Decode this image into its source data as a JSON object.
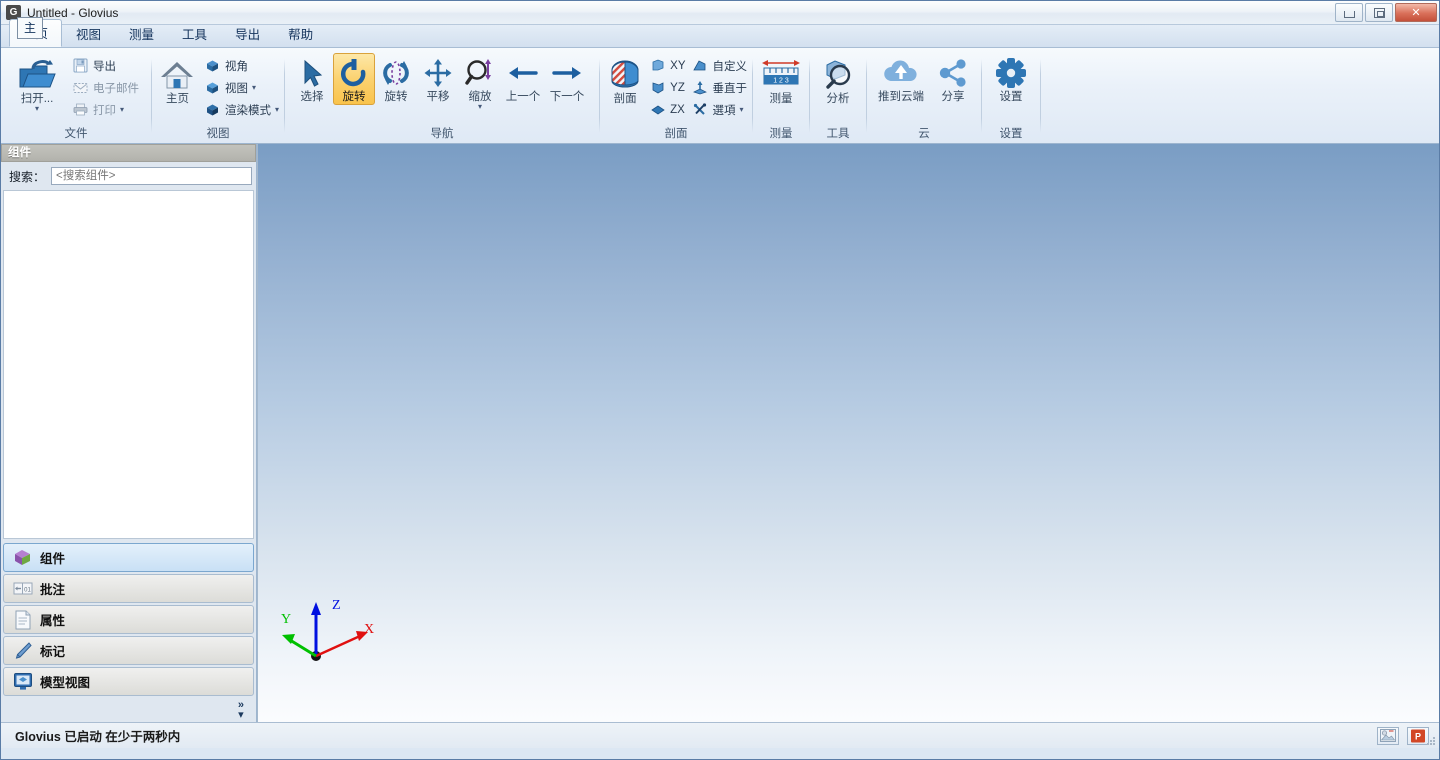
{
  "window": {
    "app_initial": "G",
    "title": "Untitled - Glovius",
    "controls": {
      "minimize": "minimize-button",
      "maximize": "maximize-button",
      "close": "✕"
    }
  },
  "menu": {
    "tabs": [
      {
        "label": "主页",
        "active": true
      },
      {
        "label": "视图",
        "active": false
      },
      {
        "label": "测量",
        "active": false
      },
      {
        "label": "工具",
        "active": false
      },
      {
        "label": "导出",
        "active": false
      },
      {
        "label": "帮助",
        "active": false
      }
    ],
    "ghost_overlay": "主"
  },
  "ribbon": {
    "groups": [
      {
        "name": "file",
        "label": "文件",
        "big": [
          {
            "label": "扫开...",
            "icon": "open-folder-icon",
            "selected": false,
            "caret": true
          }
        ],
        "small": [
          {
            "label": "导出",
            "icon": "save-export-icon",
            "caret": false
          },
          {
            "label": "电子邮件",
            "icon": "email-icon",
            "caret": false
          },
          {
            "label": "打印",
            "icon": "print-icon",
            "caret": true
          }
        ]
      },
      {
        "name": "view",
        "label": "视图",
        "big": [
          {
            "label": "主页",
            "icon": "home-icon",
            "selected": false,
            "caret": false
          }
        ],
        "small": [
          {
            "label": "视角",
            "icon": "viewpoint-cube-icon",
            "caret": false
          },
          {
            "label": "视图",
            "icon": "view-cube-icon",
            "caret": true
          },
          {
            "label": "渲染模式",
            "icon": "render-mode-cube-icon",
            "caret": true
          }
        ]
      },
      {
        "name": "navigation",
        "label": "导航",
        "big": [
          {
            "label": "选择",
            "icon": "cursor-arrow-icon",
            "selected": false,
            "caret": false
          },
          {
            "label": "旋转",
            "icon": "rotate-icon",
            "selected": true,
            "caret": false
          },
          {
            "label": "旋转",
            "icon": "spin-icon",
            "selected": false,
            "caret": false
          },
          {
            "label": "平移",
            "icon": "pan-icon",
            "selected": false,
            "caret": false
          },
          {
            "label": "缩放",
            "icon": "zoom-icon",
            "selected": false,
            "caret": true
          },
          {
            "label": "上一个",
            "icon": "arrow-left-icon",
            "selected": false,
            "caret": false
          },
          {
            "label": "下一个",
            "icon": "arrow-right-icon",
            "selected": false,
            "caret": false
          }
        ],
        "small": []
      },
      {
        "name": "section",
        "label": "剖面",
        "big": [
          {
            "label": "剖面",
            "icon": "section-cut-icon",
            "selected": false,
            "caret": false
          }
        ],
        "small_two_col": [
          [
            {
              "label": "XY",
              "icon": "plane-xy-icon",
              "caret": false
            },
            {
              "label": "YZ",
              "icon": "plane-yz-icon",
              "caret": false
            },
            {
              "label": "ZX",
              "icon": "plane-zx-icon",
              "caret": false
            }
          ],
          [
            {
              "label": "自定义",
              "icon": "custom-plane-icon",
              "caret": false
            },
            {
              "label": "垂直于",
              "icon": "perpendicular-icon",
              "caret": false
            },
            {
              "label": "選項",
              "icon": "tools-options-icon",
              "caret": true
            }
          ]
        ]
      },
      {
        "name": "measure",
        "label": "测量",
        "big": [
          {
            "label": "测量",
            "icon": "ruler-measure-icon",
            "selected": false,
            "caret": false
          }
        ],
        "small": []
      },
      {
        "name": "tools",
        "label": "工具",
        "big": [
          {
            "label": "分析",
            "icon": "analyze-magnifier-icon",
            "selected": false,
            "caret": false
          }
        ],
        "small": []
      },
      {
        "name": "cloud",
        "label": "云",
        "big": [
          {
            "label": "推到云端",
            "icon": "cloud-upload-icon",
            "selected": false,
            "caret": false
          },
          {
            "label": "分享",
            "icon": "share-icon",
            "selected": false,
            "caret": false
          }
        ],
        "small": []
      },
      {
        "name": "settings",
        "label": "设置",
        "big": [
          {
            "label": "设置",
            "icon": "gear-icon",
            "selected": false,
            "caret": false
          }
        ],
        "small": []
      }
    ]
  },
  "left_panel": {
    "header": "组件",
    "search_label": "搜索：",
    "search_value": "",
    "search_placeholder": "<搜索组件>",
    "nav_items": [
      {
        "label": "组件",
        "icon": "components-cube-icon",
        "active": true
      },
      {
        "label": "批注",
        "icon": "annotation-icon",
        "active": false
      },
      {
        "label": "属性",
        "icon": "properties-document-icon",
        "active": false
      },
      {
        "label": "标记",
        "icon": "markup-pen-icon",
        "active": false
      },
      {
        "label": "模型视图",
        "icon": "model-view-monitor-icon",
        "active": false
      }
    ],
    "expand_chevron": "»"
  },
  "viewport": {
    "axis": {
      "x_label": "X",
      "y_label": "Y",
      "z_label": "Z",
      "x_color": "#e01010",
      "y_color": "#00c000",
      "z_color": "#0010e0"
    },
    "bg_top": "#7a9dc4",
    "bg_bottom": "#fbfcfe"
  },
  "status_bar": {
    "message": "Glovius 已启动 在少于两秒内",
    "icons": [
      {
        "name": "screen-capture-icon"
      },
      {
        "name": "powerpoint-export-icon"
      }
    ]
  }
}
